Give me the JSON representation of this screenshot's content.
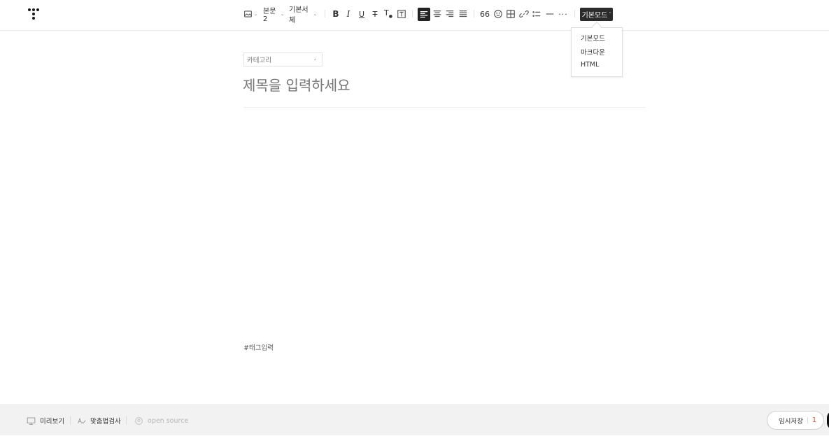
{
  "toolbar": {
    "image_icon": "image-icon",
    "paragraph_style": "본문2",
    "font_family": "기본서체",
    "mode_button": "기본모드"
  },
  "mode_menu": {
    "items": [
      "기본모드",
      "마크다운",
      "HTML"
    ]
  },
  "editor": {
    "category_placeholder": "카테고리",
    "title_placeholder": "제목을 입력하세요",
    "tag_placeholder": "#태그입력"
  },
  "footer": {
    "preview": "미리보기",
    "spellcheck": "맞춤법검사",
    "open_source": "open source",
    "temp_save": "임시저장",
    "temp_save_count": "1"
  },
  "colors": {
    "accent": "#e2522d",
    "dark": "#2b2b2b"
  }
}
